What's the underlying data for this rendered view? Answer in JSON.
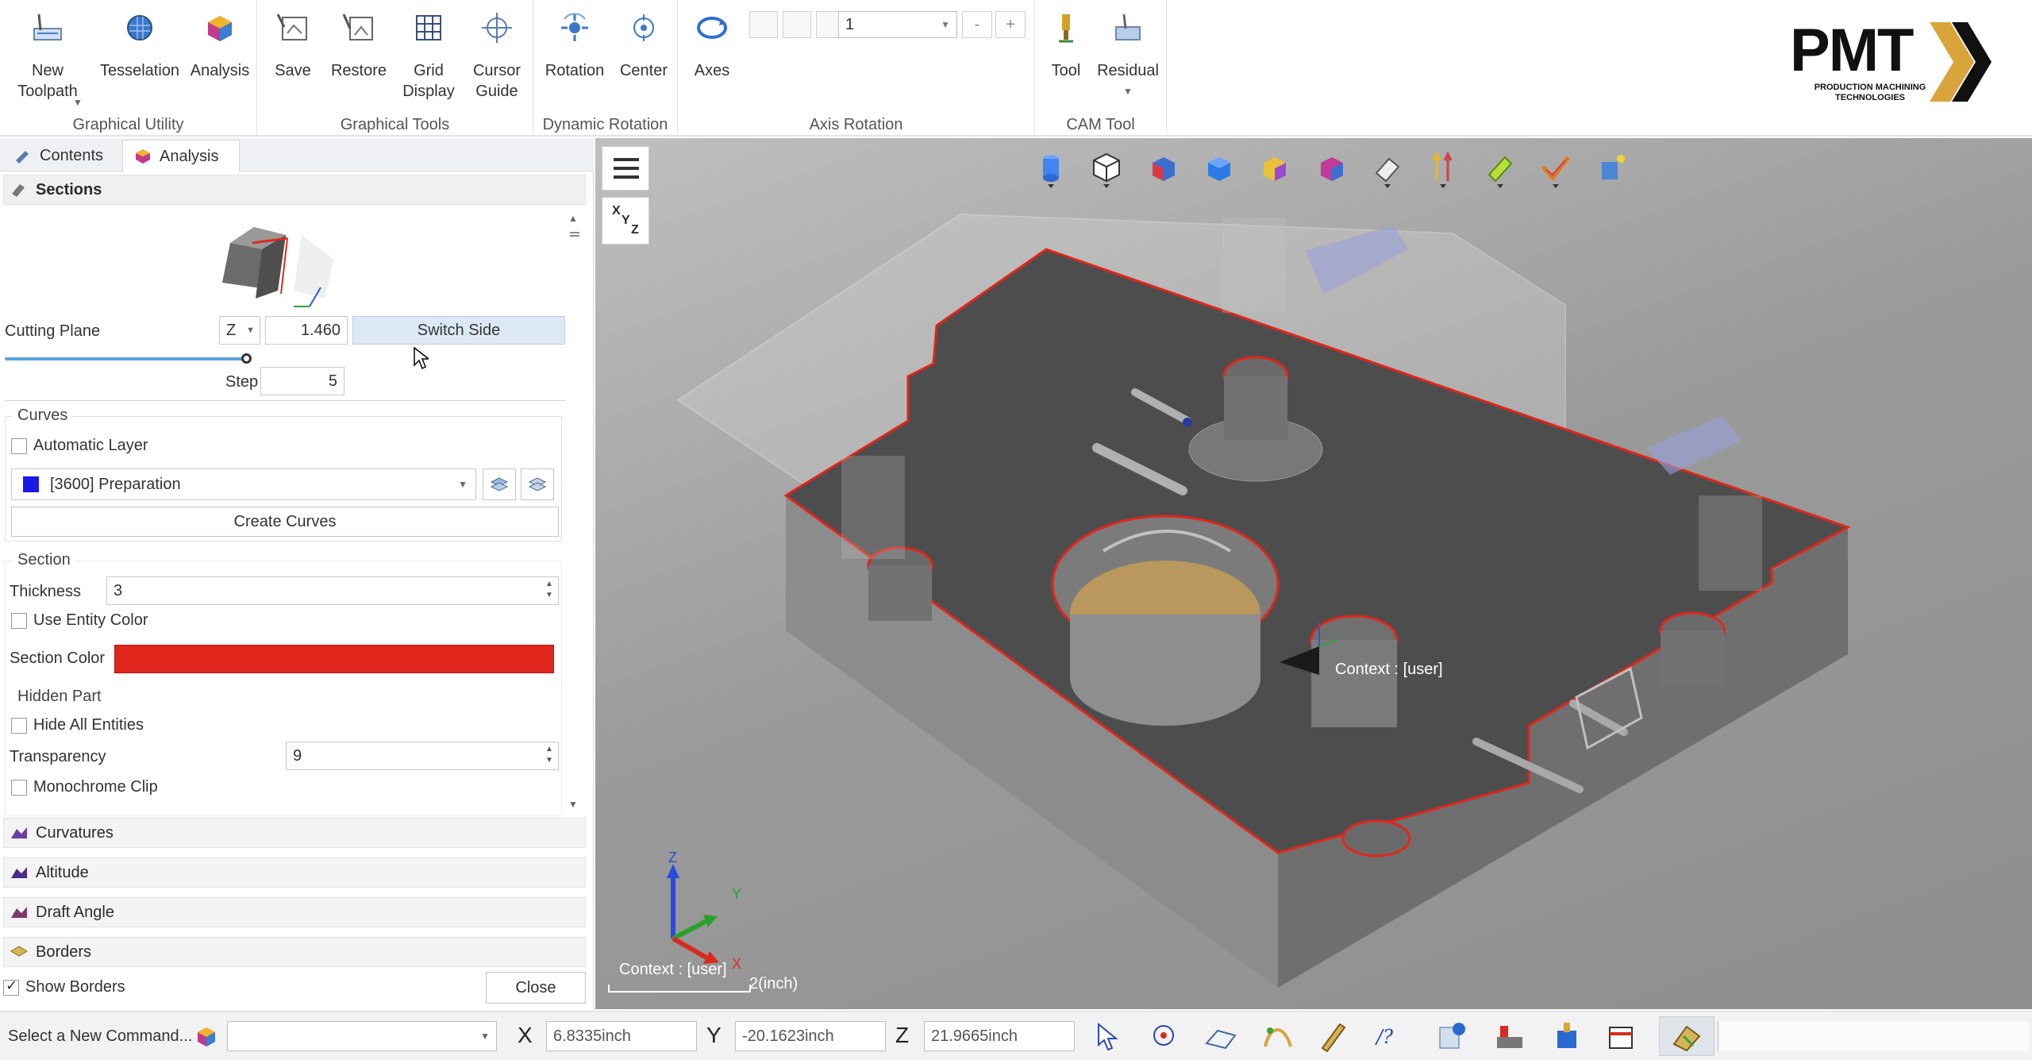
{
  "ribbon": {
    "groups": {
      "graphical_utility": "Graphical Utility",
      "graphical_tools": "Graphical Tools",
      "dynamic_rotation": "Dynamic Rotation",
      "axis_rotation": "Axis Rotation",
      "cam_tool": "CAM Tool"
    },
    "buttons": {
      "new_toolpath": "New\nToolpath",
      "tesselation": "Tesselation",
      "analysis": "Analysis",
      "save": "Save",
      "restore": "Restore",
      "grid_display": "Grid\nDisplay",
      "cursor_guide": "Cursor\nGuide",
      "rotation": "Rotation",
      "center": "Center",
      "axes": "Axes",
      "tool": "Tool",
      "residual": "Residual"
    },
    "axis_value": "1",
    "minus": "-",
    "plus": "+"
  },
  "logo": {
    "main": "PMT",
    "tagline": "PRODUCTION MACHINING\nTECHNOLOGIES"
  },
  "panel": {
    "tabs": [
      "Contents",
      "Analysis"
    ],
    "sections_header": "Sections",
    "cutting_plane_label": "Cutting Plane",
    "cutting_axis": "Z",
    "cutting_value": "1.460",
    "switch_side": "Switch Side",
    "step_label": "Step",
    "step_value": "5",
    "curves": {
      "title": "Curves",
      "automatic_layer": "Automatic Layer",
      "layer": "[3600] Preparation",
      "layer_color": "#1a1ae6",
      "create_curves": "Create Curves"
    },
    "section": {
      "title": "Section",
      "thickness_label": "Thickness",
      "thickness_value": "3",
      "use_entity_color": "Use Entity Color",
      "section_color_label": "Section Color",
      "section_color": "#e0261c"
    },
    "hidden_part": {
      "title": "Hidden Part",
      "hide_all": "Hide All Entities",
      "transparency_label": "Transparency",
      "transparency_value": "9",
      "monochrome_clip": "Monochrome Clip"
    },
    "collapsed": [
      "Curvatures",
      "Altitude",
      "Draft Angle",
      "Borders"
    ],
    "show_borders": "Show Borders",
    "close": "Close"
  },
  "viewport": {
    "context_label": "Context : [user]",
    "scale": "2(inch)",
    "axis_z": "Z",
    "axis_y": "Y",
    "axis_x": "X",
    "xyz_top": "X",
    "xyz_mid": "Y",
    "xyz_bot": "Z"
  },
  "statusbar": {
    "command": "Select a New Command...",
    "x_label": "X",
    "x_value": "6.8335inch",
    "y_label": "Y",
    "y_value": "-20.1623inch",
    "z_label": "Z",
    "z_value": "21.9665inch"
  }
}
